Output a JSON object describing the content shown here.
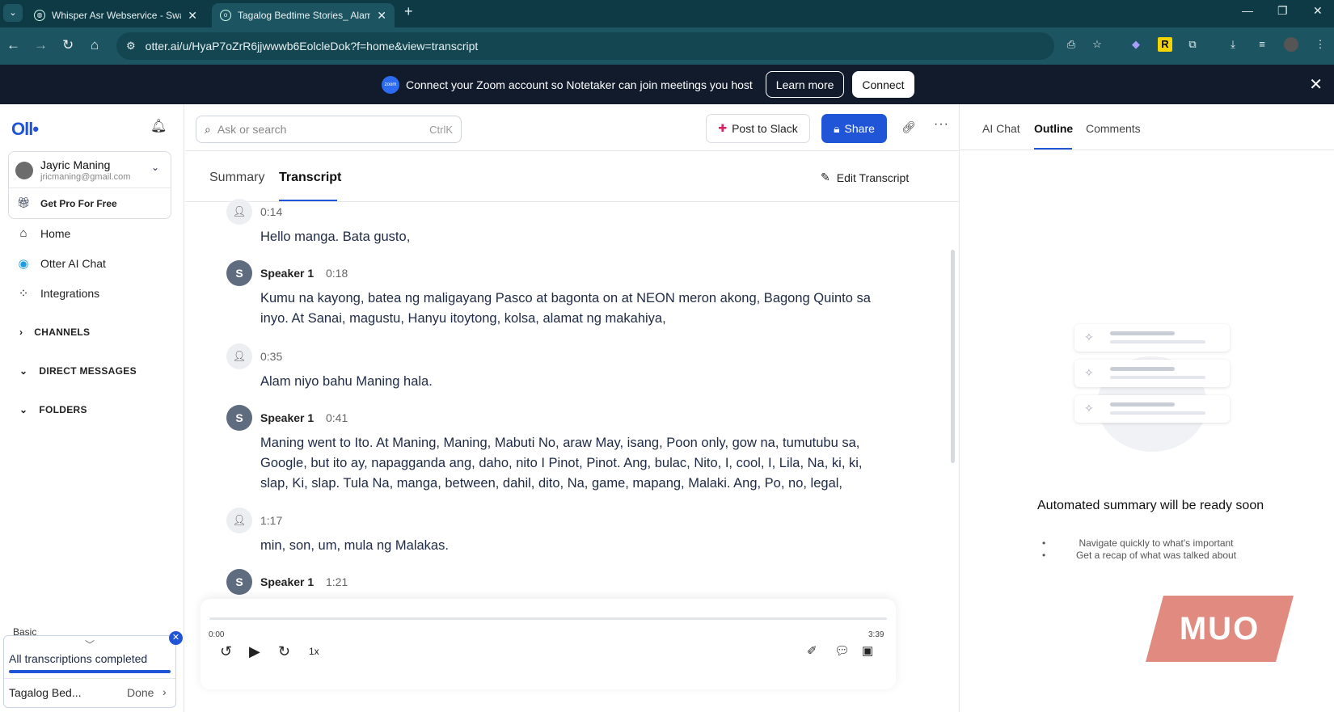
{
  "browser": {
    "tabs": [
      {
        "title": "Whisper Asr Webservice - Swag",
        "active": false
      },
      {
        "title": "Tagalog Bedtime Stories_ Alamat",
        "active": true
      }
    ],
    "url": "otter.ai/u/HyaP7oZrR6jjwwwb6EolcleDok?f=home&view=transcript"
  },
  "banner": {
    "message": "Connect your Zoom account so Notetaker can join meetings you host",
    "learn_more": "Learn more",
    "connect": "Connect"
  },
  "sidebar": {
    "logo": "Oll•",
    "account": {
      "name": "Jayric Maning",
      "email": "jricmaning@gmail.com"
    },
    "get_pro": "Get Pro For Free",
    "nav": [
      {
        "label": "Home",
        "icon": "home-icon"
      },
      {
        "label": "Otter AI Chat",
        "icon": "otter-chat-icon"
      },
      {
        "label": "Integrations",
        "icon": "integrations-icon"
      }
    ],
    "sections": [
      {
        "label": "CHANNELS",
        "expanded": false
      },
      {
        "label": "DIRECT MESSAGES",
        "expanded": true
      },
      {
        "label": "FOLDERS",
        "expanded": true
      }
    ],
    "plan": "Basic",
    "toast": {
      "title": "All transcriptions completed",
      "file": "Tagalog Bed...",
      "status": "Done"
    }
  },
  "toolbar": {
    "search_placeholder": "Ask or search",
    "search_shortcut": "CtrlK",
    "post_to_slack": "Post to Slack",
    "share": "Share"
  },
  "tabs": {
    "summary": "Summary",
    "transcript": "Transcript",
    "edit": "Edit Transcript"
  },
  "transcript": [
    {
      "speaker": "",
      "initial": "",
      "time": "0:14",
      "text": "Hello manga. Bata gusto,"
    },
    {
      "speaker": "Speaker 1",
      "initial": "S",
      "time": "0:18",
      "text": "Kumu na kayong, batea ng maligayang Pasco at bagonta on at NEON meron akong, Bagong Quinto sa inyo. At Sanai, magustu, Hanyu itoytong, kolsa, alamat ng makahiya,"
    },
    {
      "speaker": "",
      "initial": "",
      "time": "0:35",
      "text": "Alam niyo bahu Maning hala."
    },
    {
      "speaker": "Speaker 1",
      "initial": "S",
      "time": "0:41",
      "text": "Maning went to Ito. At Maning, Maning, Mabuti No, araw May, isang, Poon only, gow na, tumutubu sa, Google, but ito ay, napagganda ang, daho, nito I Pinot, Pinot. Ang, bulac, Nito, I, cool, I, Lila, Na, ki, ki, slap, Ki, slap. Tula Na, manga, between, dahil, dito, Na, game, mapang, Malaki. Ang, Po, no, legal,"
    },
    {
      "speaker": "",
      "initial": "",
      "time": "1:17",
      "text": "min, son, um, mula ng Malakas."
    },
    {
      "speaker": "Speaker 1",
      "initial": "S",
      "time": "1:21",
      "text": ""
    }
  ],
  "player": {
    "current": "0:00",
    "duration": "3:39",
    "speed": "1x",
    "progress": 0
  },
  "right_panel": {
    "tabs": [
      "AI Chat",
      "Outline",
      "Comments"
    ],
    "active_tab": "Outline",
    "title": "Automated summary will be ready soon",
    "bullets": [
      "Navigate quickly to what's important",
      "Get a recap of what was talked about"
    ]
  },
  "watermark": "MUO",
  "colors": {
    "accent": "#1f55d6",
    "banner": "#111b2c",
    "browser": "#1d5461"
  }
}
